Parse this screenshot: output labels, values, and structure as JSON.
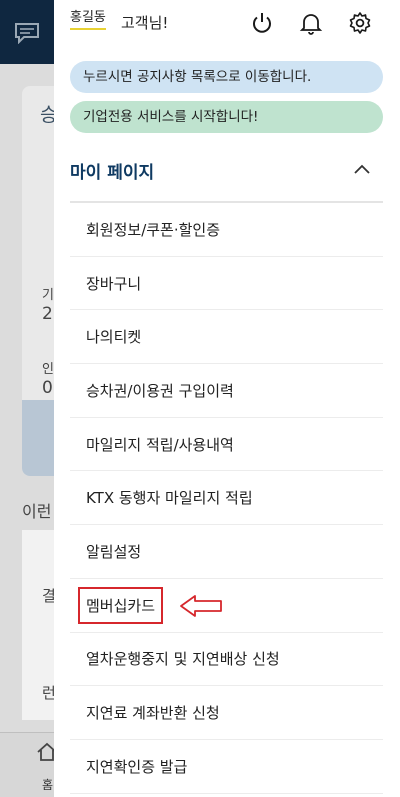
{
  "user": {
    "name": "홍길동",
    "suffix": "고객님!"
  },
  "notices": [
    {
      "text": "누르시면 공지사항 목록으로 이동합니다."
    },
    {
      "text": "기업전용 서비스를 시작합니다!"
    }
  ],
  "section": {
    "title": "마이 페이지"
  },
  "menu": [
    {
      "label": "회원정보/쿠폰·할인증"
    },
    {
      "label": "장바구니"
    },
    {
      "label": "나의티켓"
    },
    {
      "label": "승차권/이용권 구입이력"
    },
    {
      "label": "마일리지 적립/사용내역"
    },
    {
      "label": "KTX 동행자 마일리지 적립"
    },
    {
      "label": "알림설정"
    },
    {
      "label": "멤버십카드"
    },
    {
      "label": "열차운행중지 및 지연배상 신청"
    },
    {
      "label": "지연료 계좌반환 신청"
    },
    {
      "label": "지연확인증 발급"
    }
  ],
  "background": {
    "fragments": [
      "승",
      "기",
      "2",
      "인",
      "0",
      "이런",
      "결",
      "런",
      "홈"
    ]
  },
  "colors": {
    "accent": "#0f3a62",
    "highlight": "#d6272c",
    "notice_blue": "#cfe3f3",
    "notice_green": "#bfe3cf",
    "header_bg": "#0f2740"
  },
  "icons": {
    "power": "power-icon",
    "bell": "bell-icon",
    "settings": "gear-icon",
    "toggle": "chevron-up-icon",
    "arrow": "arrow-left-icon"
  }
}
